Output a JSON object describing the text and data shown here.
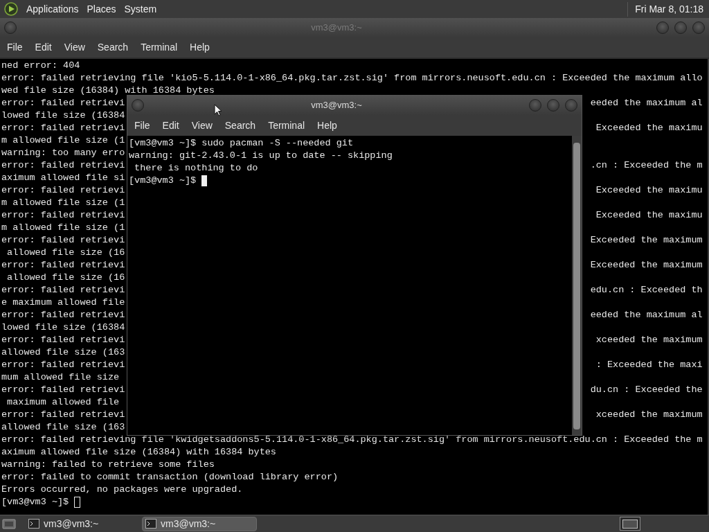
{
  "top_panel": {
    "menus": [
      "Applications",
      "Places",
      "System"
    ],
    "clock": "Fri Mar 8, 01:18"
  },
  "back_window": {
    "title": "vm3@vm3:~",
    "active": false,
    "menu": [
      "File",
      "Edit",
      "View",
      "Search",
      "Terminal",
      "Help"
    ],
    "lines_top": [
      "ned error: 404",
      "error: failed retrieving file 'kio5-5.114.0-1-x86_64.pkg.tar.zst.sig' from mirrors.neusoft.edu.cn : Exceeded the maximum allo",
      "wed file size (16384) with 16384 bytes"
    ],
    "split_lines": [
      {
        "left": "error: failed retrievi",
        "right": "eeded the maximum al"
      },
      {
        "left": "lowed file size (16384"
      },
      {
        "left": "error: failed retrievi",
        "right": "Exceeded the maximu"
      },
      {
        "left": "m allowed file size (1"
      },
      {
        "left": "warning: too many erro"
      },
      {
        "left": "error: failed retrievi",
        "right": ".cn : Exceeded the m"
      },
      {
        "left": "aximum allowed file si"
      },
      {
        "left": "error: failed retrievi",
        "right": "Exceeded the maximu"
      },
      {
        "left": "m allowed file size (1"
      },
      {
        "left": "error: failed retrievi",
        "right": "Exceeded the maximu"
      },
      {
        "left": "m allowed file size (1"
      },
      {
        "left": "error: failed retrievi",
        "right": "Exceeded the maximum"
      },
      {
        "left": " allowed file size (16"
      },
      {
        "left": "error: failed retrievi",
        "right": "Exceeded the maximum"
      },
      {
        "left": " allowed file size (16"
      },
      {
        "left": "error: failed retrievi",
        "right": "edu.cn : Exceeded th"
      },
      {
        "left": "e maximum allowed file"
      },
      {
        "left": "error: failed retrievi",
        "right": "eeded the maximum al"
      },
      {
        "left": "lowed file size (16384"
      },
      {
        "left": "error: failed retrievi",
        "right": "xceeded the maximum"
      },
      {
        "left": "allowed file size (163"
      },
      {
        "left": "error: failed retrievi",
        "right": ": Exceeded the maxi"
      },
      {
        "left": "mum allowed file size"
      },
      {
        "left": "error: failed retrievi",
        "right": "du.cn : Exceeded the"
      },
      {
        "left": " maximum allowed file"
      },
      {
        "left": "error: failed retrievi",
        "right": "xceeded the maximum"
      },
      {
        "left": "allowed file size (163"
      }
    ],
    "lines_bottom": [
      "error: failed retrieving file 'kwidgetsaddons5-5.114.0-1-x86_64.pkg.tar.zst.sig' from mirrors.neusoft.edu.cn : Exceeded the m",
      "aximum allowed file size (16384) with 16384 bytes",
      "warning: failed to retrieve some files",
      "error: failed to commit transaction (download library error)",
      "Errors occurred, no packages were upgraded."
    ],
    "prompt": "[vm3@vm3 ~]$"
  },
  "front_window": {
    "title": "vm3@vm3:~",
    "active": true,
    "menu": [
      "File",
      "Edit",
      "View",
      "Search",
      "Terminal",
      "Help"
    ],
    "lines": [
      "[vm3@vm3 ~]$ sudo pacman -S --needed git",
      "warning: git-2.43.0-1 is up to date -- skipping",
      " there is nothing to do"
    ],
    "prompt": "[vm3@vm3 ~]$"
  },
  "taskbar": {
    "tasks": [
      {
        "label": "vm3@vm3:~",
        "selected": false
      },
      {
        "label": "vm3@vm3:~",
        "selected": true
      }
    ]
  }
}
